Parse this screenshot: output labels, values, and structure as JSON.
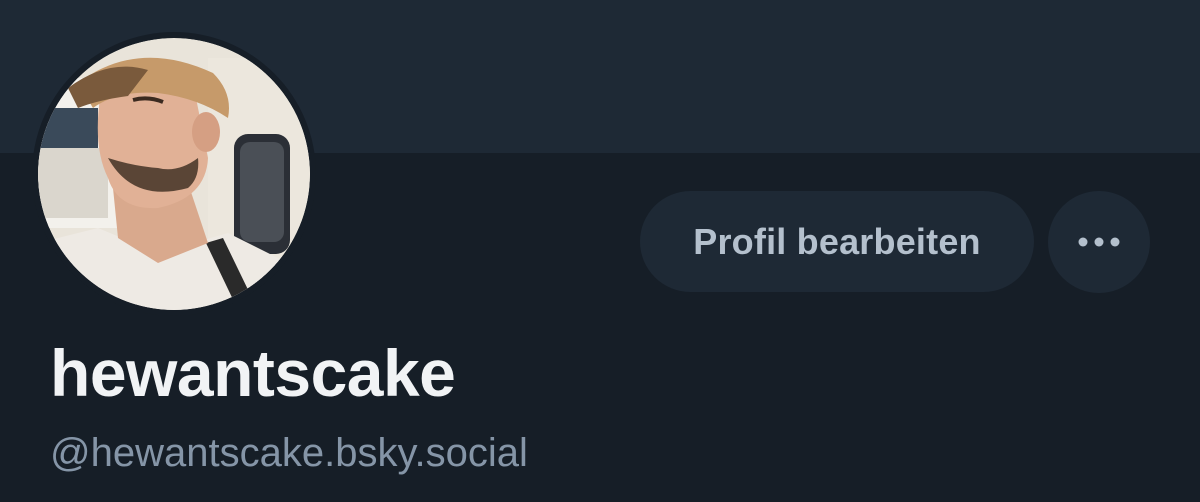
{
  "profile": {
    "display_name": "hewantscake",
    "handle": "@hewantscake.bsky.social",
    "avatar_description": "avatar-photo"
  },
  "actions": {
    "edit_profile_label": "Profil bearbeiten",
    "more_icon": "ellipsis-icon"
  },
  "colors": {
    "background": "#161e27",
    "banner": "#1e2935",
    "button_bg": "#1e2935",
    "button_text": "#b4c0cd",
    "name_text": "#f1f3f5",
    "handle_text": "#8595a7"
  }
}
